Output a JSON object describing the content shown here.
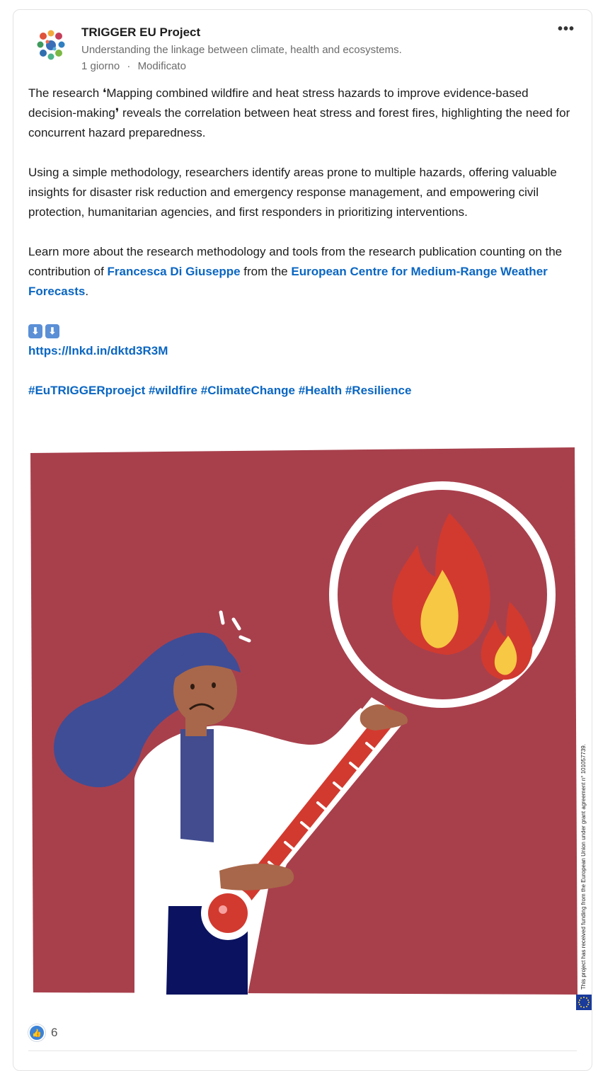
{
  "post": {
    "author": "TRIGGER EU Project",
    "tagline": "Understanding the linkage between climate, health and ecosystems.",
    "time": "1 giorno",
    "separator": "·",
    "edited": "Modificato",
    "more_label": "•••"
  },
  "content": {
    "p1": "The research ❛Mapping combined wildfire and heat stress hazards to improve evidence-based decision-making❜ reveals the correlation between heat stress and forest fires, highlighting the need for concurrent hazard preparedness.",
    "p2": "Using a simple methodology, researchers identify areas prone to multiple hazards, offering valuable insights for disaster risk reduction and emergency response management, and empowering civil protection, humanitarian agencies, and first responders in prioritizing interventions.",
    "p3_start": "Learn more about the research methodology and tools from the research publication counting on the contribution of ",
    "p3_person": "Francesca Di Giuseppe",
    "p3_mid": " from the ",
    "p3_org": "European Centre for Medium-Range Weather Forecasts",
    "p3_end": ".",
    "arrow": "⬇",
    "url": "https://lnkd.in/dktd3R3M",
    "hashtags": [
      "#EuTRIGGERproejct",
      "#wildfire",
      "#ClimateChange",
      "#Health",
      "#Resilience"
    ]
  },
  "image": {
    "credit": "This project has received funding from the European Union under grant agreement n° 101057739.",
    "colors": {
      "background": "#a8404c",
      "lens_ring": "#ffffff",
      "flame_red": "#d23a2f",
      "flame_yellow": "#f7c843",
      "hair": "#3f4d96",
      "skin": "#a8674a",
      "coat": "#ffffff",
      "thermo": "#d23a2f"
    }
  },
  "reactions": {
    "icon": "thumbs-up",
    "count": "6"
  }
}
